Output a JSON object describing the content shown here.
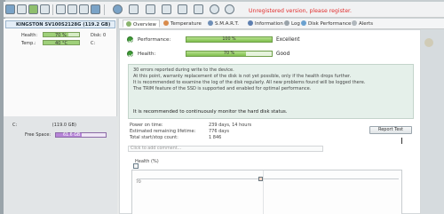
{
  "toolbar": {
    "unregistered_text": "Unregistered version, please register."
  },
  "drive": {
    "title": "KINGSTON SV100S2128G  (119.2 GB)",
    "health_label": "Health:",
    "health_value": "70 %",
    "health_right": "Disk: 0",
    "temp_label": "Temp.:",
    "temp_value": "40 °C",
    "temp_right": "C:"
  },
  "volume": {
    "label": "C:",
    "size": "(119.0 GB)",
    "free_label": "Free Space:",
    "free_value": "61.6 GB"
  },
  "tabs": [
    {
      "label": "Overview"
    },
    {
      "label": "Temperature"
    },
    {
      "label": "S.M.A.R.T."
    },
    {
      "label": "Information"
    },
    {
      "label": "Log"
    },
    {
      "label": "Disk Performance"
    },
    {
      "label": "Alerts"
    }
  ],
  "overview": {
    "performance_label": "Performance:",
    "performance_value": "100 %",
    "performance_pct": 100,
    "performance_status": "Excellent",
    "health_label": "Health:",
    "health_value": "70 %",
    "health_pct": 70,
    "health_status": "Good",
    "message_lines": [
      "30 errors reported during write to the device.",
      "At this point, warranty replacement of the disk is not yet possible, only if the health drops further.",
      "It is recommended to examine the log of the disk regularly. All new problems found will be logged there.",
      "The TRIM feature of the SSD is supported and enabled for optimal performance."
    ],
    "message_strong": "It is recommended to continuously monitor the hard disk status.",
    "power_on_label": "Power on time:",
    "power_on_value": "239 days, 14 hours",
    "lifetime_label": "Estimated remaining lifetime:",
    "lifetime_value": "776 days",
    "starts_label": "Total start/stop count:",
    "starts_value": "1 846",
    "comment_placeholder": "Click to add comment...",
    "report_button": "Report Test",
    "health_chart_title": "Health (%)",
    "health_chart_ylabel": "70"
  },
  "colors": {
    "unregistered": "#e12d2d",
    "ok_green": "#3f9a36",
    "bar_green": "#7fbf4d",
    "free_purple": "#b784d8",
    "message_bg": "#e5f0ea"
  }
}
